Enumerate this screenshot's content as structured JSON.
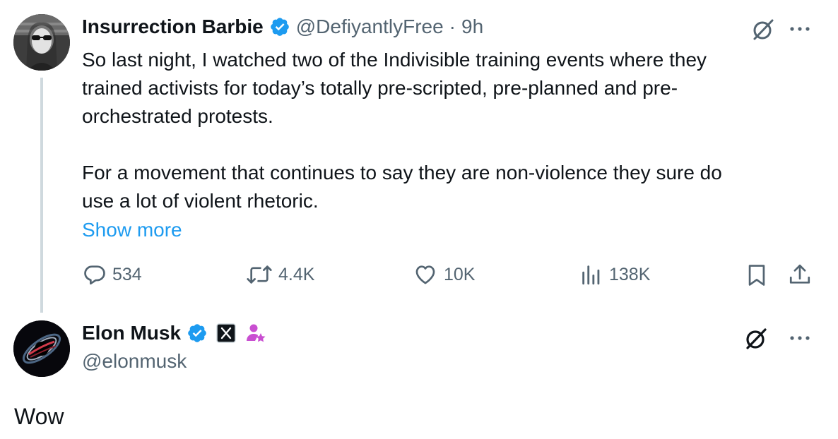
{
  "tweet": {
    "author_name": "Insurrection Barbie",
    "handle": "@DefiyantlyFree",
    "separator": "·",
    "time": "9h",
    "text_lines": [
      "So last night, I watched two of the Indivisible training events where they",
      "trained activists for today’s totally pre-scripted, pre-planned and pre-",
      "orchestrated protests.",
      "For a movement that continues to say they are non-violence they sure do",
      "use a lot of violent rhetoric."
    ],
    "show_more": "Show more",
    "stats": {
      "replies": "534",
      "reposts": "4.4K",
      "likes": "10K",
      "views": "138K"
    }
  },
  "reply": {
    "author_name": "Elon Musk",
    "handle": "@elonmusk",
    "text": "Wow"
  },
  "colors": {
    "verified": "#1d9bf0",
    "link": "#1d9bf0",
    "secondary": "#536471",
    "badge_pink": "#c94fd1"
  },
  "icons": [
    "grok-icon",
    "more-icon",
    "reply-icon",
    "repost-icon",
    "like-icon",
    "views-icon",
    "bookmark-icon",
    "share-icon",
    "verified-badge-icon",
    "x-affiliate-badge-icon",
    "subscriber-badge-icon"
  ]
}
